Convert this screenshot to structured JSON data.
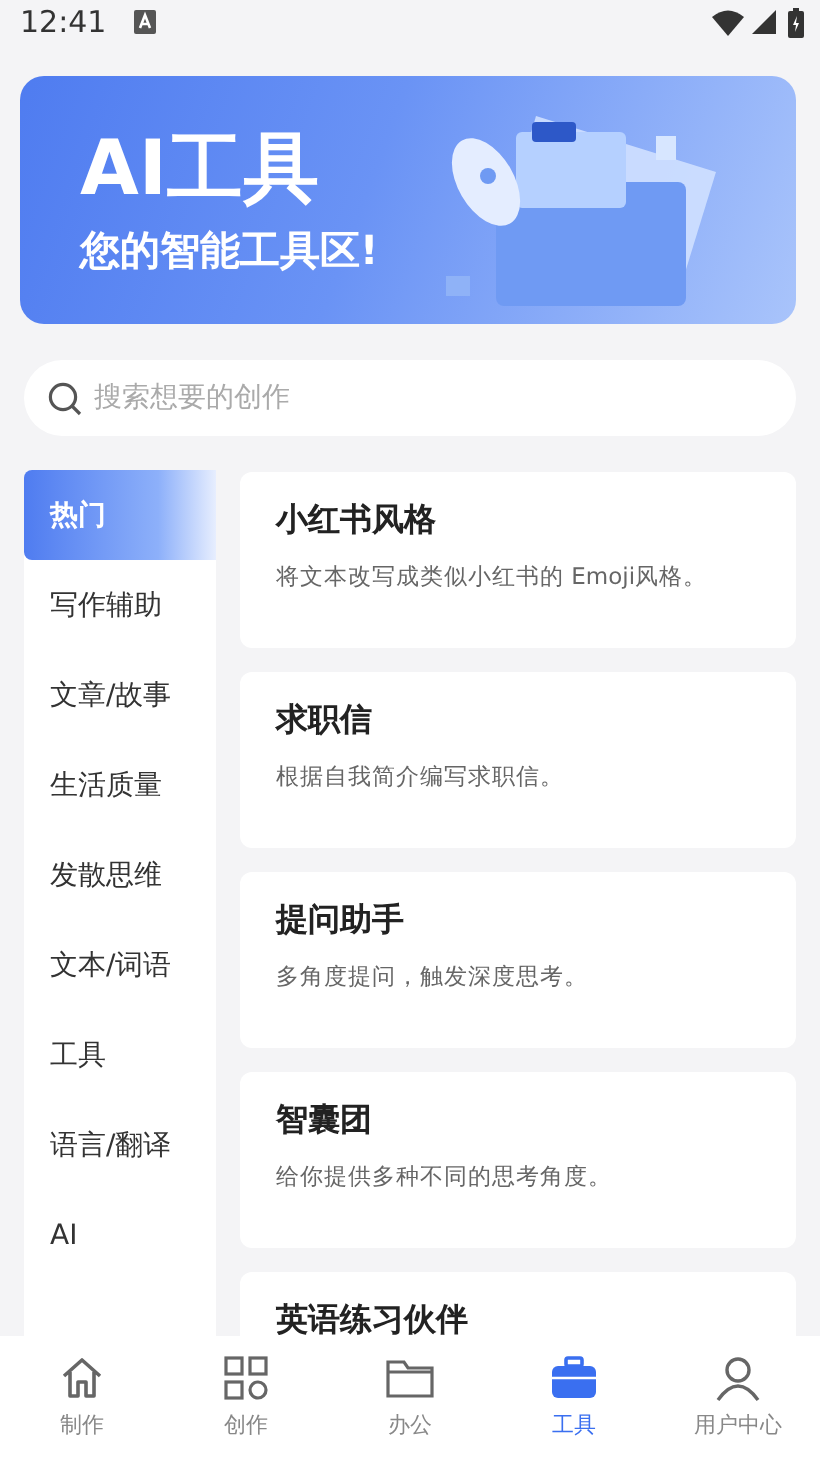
{
  "status_bar": {
    "time": "12:41"
  },
  "banner": {
    "title": "AI工具",
    "subtitle": "您的智能工具区!"
  },
  "search": {
    "placeholder": "搜索想要的创作"
  },
  "sidebar": {
    "items": [
      {
        "label": "热门",
        "selected": true
      },
      {
        "label": "写作辅助",
        "selected": false
      },
      {
        "label": "文章/故事",
        "selected": false
      },
      {
        "label": "生活质量",
        "selected": false
      },
      {
        "label": "发散思维",
        "selected": false
      },
      {
        "label": "文本/词语",
        "selected": false
      },
      {
        "label": "工具",
        "selected": false
      },
      {
        "label": "语言/翻译",
        "selected": false
      },
      {
        "label": "AI",
        "selected": false
      }
    ]
  },
  "tools": [
    {
      "title": "小红书风格",
      "description": "将文本改写成类似小红书的 Emoji风格。"
    },
    {
      "title": "求职信",
      "description": "根据自我简介编写求职信。"
    },
    {
      "title": "提问助手",
      "description": "多角度提问，触发深度思考。"
    },
    {
      "title": "智囊团",
      "description": "给你提供多种不同的思考角度。"
    },
    {
      "title": "英语练习伙伴"
    }
  ],
  "bottom_nav": [
    {
      "label": "制作",
      "selected": false
    },
    {
      "label": "创作",
      "selected": false
    },
    {
      "label": "办公",
      "selected": false
    },
    {
      "label": "工具",
      "selected": true
    },
    {
      "label": "用户中心",
      "selected": false
    }
  ]
}
